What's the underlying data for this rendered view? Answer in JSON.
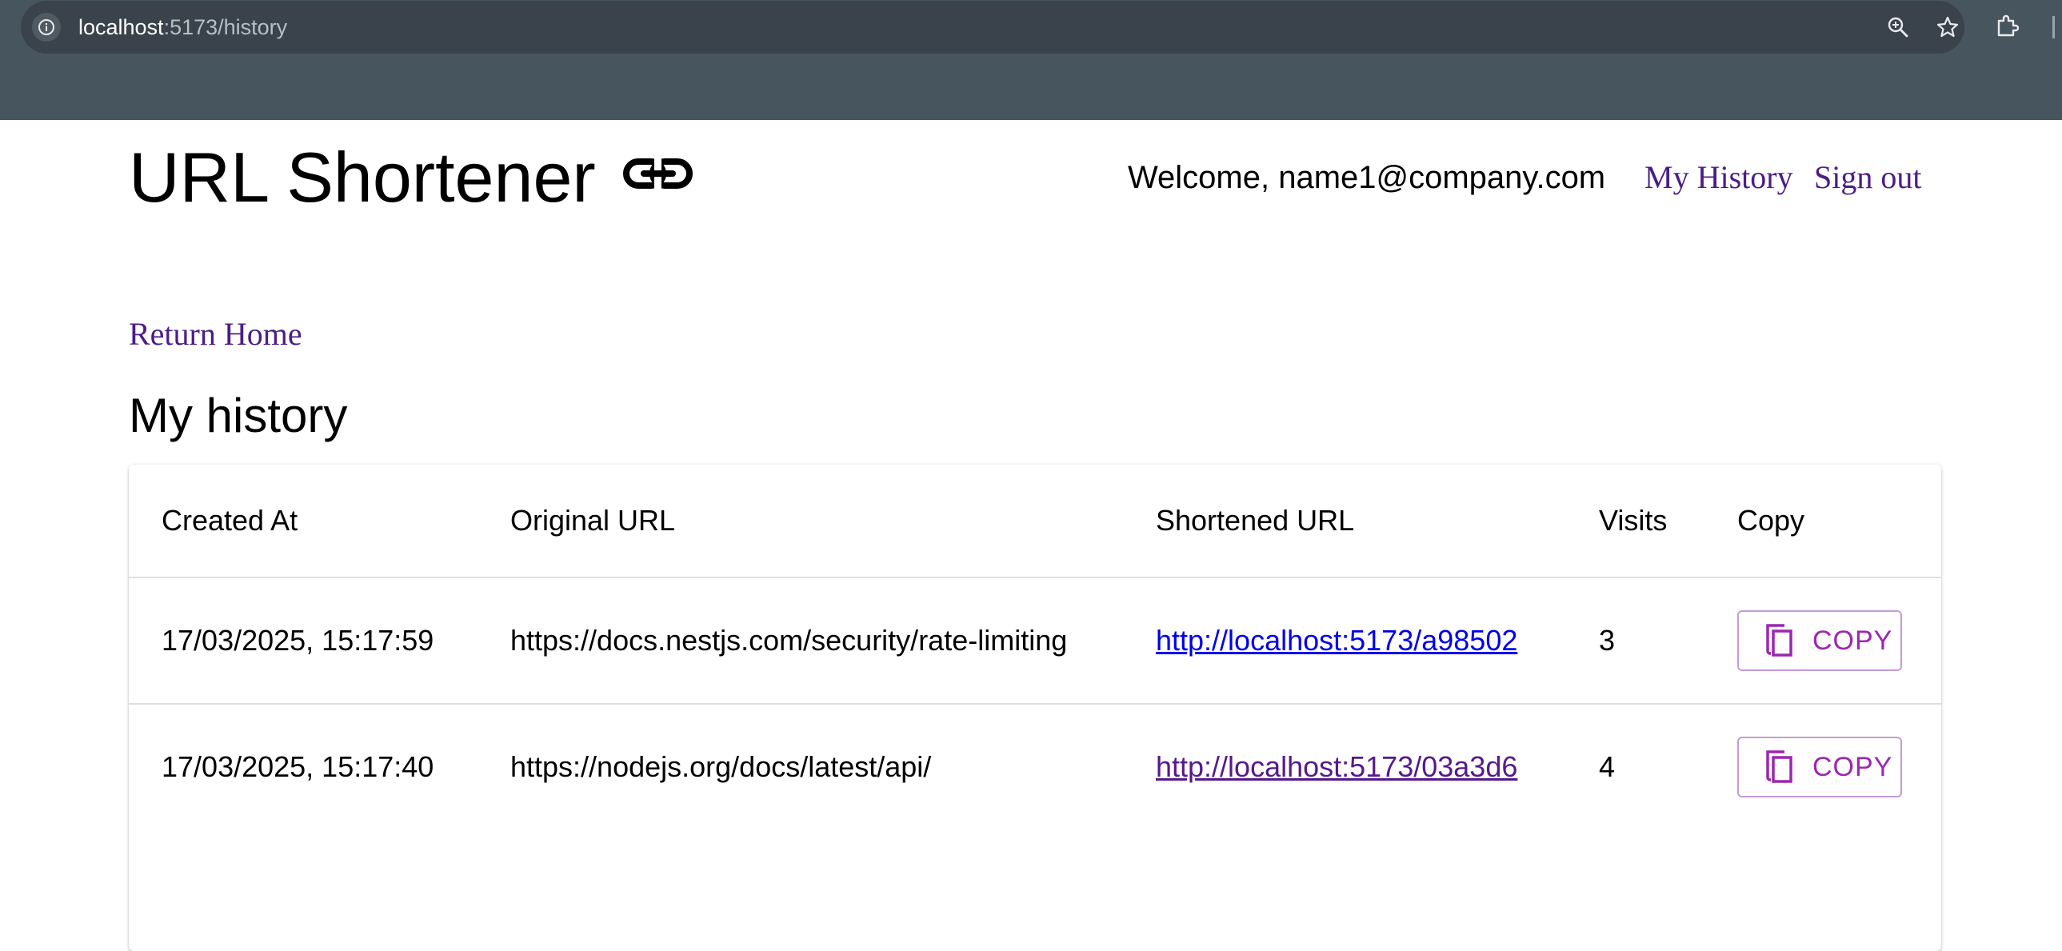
{
  "browser": {
    "url_host": "localhost",
    "url_path": ":5173/history"
  },
  "header": {
    "title": "URL Shortener",
    "welcome": "Welcome, name1@company.com",
    "nav": {
      "history": "My History",
      "signout": "Sign out"
    }
  },
  "main": {
    "return_home": "Return Home",
    "section_title": "My history"
  },
  "table": {
    "columns": [
      "Created At",
      "Original URL",
      "Shortened URL",
      "Visits",
      "Copy"
    ],
    "rows": [
      {
        "created_at": "17/03/2025, 15:17:59",
        "original_url": "https://docs.nestjs.com/security/rate-limiting",
        "short_url": "http://localhost:5173/a98502",
        "visits": "3",
        "copy_label": "COPY"
      },
      {
        "created_at": "17/03/2025, 15:17:40",
        "original_url": "https://nodejs.org/docs/latest/api/",
        "short_url": "http://localhost:5173/03a3d6",
        "visits": "4",
        "copy_label": "COPY"
      }
    ]
  },
  "icons": {
    "site_info": "info-icon",
    "zoom": "zoom-in-icon",
    "bookmark": "star-icon",
    "extensions": "puzzle-icon",
    "logo": "link-icon",
    "copy": "content-copy-icon"
  },
  "colors": {
    "link_purple": "#4b1d86",
    "link_blue": "#0000ee",
    "button_purple": "#9c27b0",
    "chrome_bg": "#47555f"
  }
}
